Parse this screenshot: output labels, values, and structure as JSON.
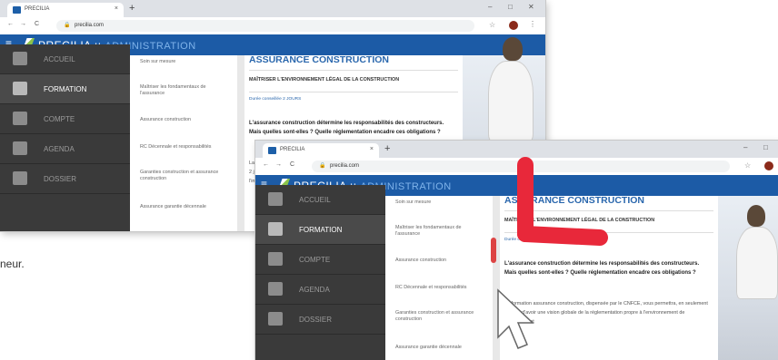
{
  "browser": {
    "tab_title": "PRECILIA",
    "tab_close": "×",
    "new_tab": "+",
    "url": "precilia.com",
    "minimize": "–",
    "maximize": "□",
    "close": "✕",
    "back": "←",
    "forward": "→",
    "reload": "C",
    "bookmark": "☆",
    "menu": "⋮"
  },
  "app": {
    "menu_icon": "≡",
    "brand_name": "PRECILIA",
    "brand_sep": " :: ",
    "brand_section": "ADMINISTRATION"
  },
  "sidebar": {
    "items": [
      {
        "label": "Accueil",
        "icon": "home-icon"
      },
      {
        "label": "Formation",
        "icon": "classroom-icon"
      },
      {
        "label": "Compte",
        "icon": "document-icon"
      },
      {
        "label": "Agenda",
        "icon": "calendar-icon"
      },
      {
        "label": "Dossier",
        "icon": "folder-icon"
      }
    ]
  },
  "submenu": {
    "items": [
      "Soin sur mesure",
      "Maîtriser les fondamentaux de l'assurance",
      "Assurance construction",
      "RC Décennale et responsabilités",
      "Garanties construction et assurance construction",
      "Assurance garantie décennale"
    ]
  },
  "course": {
    "title": "ASSURANCE CONSTRUCTION",
    "subtitle": "MAÎTRISER L'ENVIRONNEMENT LÉGAL DE LA CONSTRUCTION",
    "duration": "Durée conseillée 2 JOURS",
    "intro_bold": "L'assurance construction détermine les responsabilités des constructeurs. Mais quelles sont-elles ? Quelle réglementation encadre ces obligations ?",
    "paragraph": "La formation assurance construction, dispensée par le CNFCE, vous permettra, en seulement 2 jours, d'avoir une vision globale de la réglementation propre à l'environnement de l'immobilier et"
  },
  "page_text": {
    "leftover": "neur."
  },
  "colors": {
    "appbar": "#1c5ba6",
    "sidebar": "#3a3a3a",
    "accent_title": "#2a67ad",
    "arrow": "#e8283a"
  }
}
